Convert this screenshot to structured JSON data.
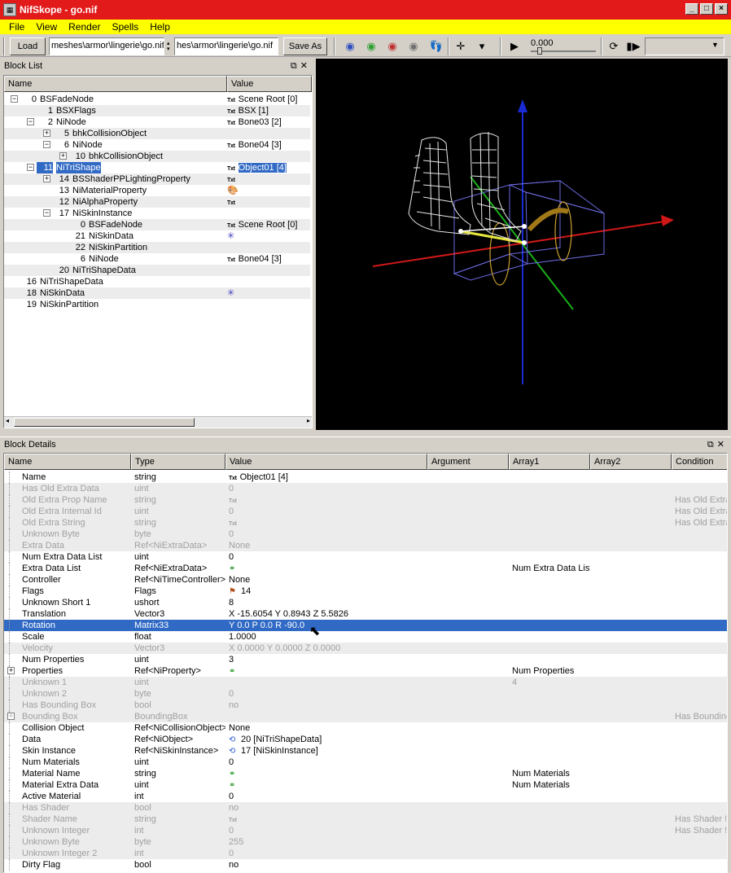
{
  "window": {
    "title": "NifSkope - go.nif",
    "controls": [
      "_",
      "□",
      "×"
    ]
  },
  "menu": [
    "File",
    "View",
    "Render",
    "Spells",
    "Help"
  ],
  "toolbar": {
    "load_label": "Load",
    "load_path": "meshes\\armor\\lingerie\\go.nif",
    "save_path": "hes\\armor\\lingerie\\go.nif",
    "save_label": "Save As",
    "time_value": "0.000"
  },
  "block_list": {
    "title": "Block List",
    "columns": [
      "Name",
      "Value"
    ],
    "rows": [
      {
        "num": "0",
        "name": "BSFadeNode",
        "value": "Scene Root [0]",
        "txt": true,
        "depth": 0,
        "toggle": "-"
      },
      {
        "num": "1",
        "name": "BSXFlags",
        "value": "BSX [1]",
        "txt": true,
        "depth": 1,
        "toggle": ""
      },
      {
        "num": "2",
        "name": "NiNode",
        "value": "Bone03 [2]",
        "txt": true,
        "depth": 1,
        "toggle": "-"
      },
      {
        "num": "5",
        "name": "bhkCollisionObject",
        "value": "",
        "txt": false,
        "depth": 2,
        "toggle": "+"
      },
      {
        "num": "6",
        "name": "NiNode",
        "value": "Bone04 [3]",
        "txt": true,
        "depth": 2,
        "toggle": "-"
      },
      {
        "num": "10",
        "name": "bhkCollisionObject",
        "value": "",
        "txt": false,
        "depth": 3,
        "toggle": "+"
      },
      {
        "num": "11",
        "name": "NiTriShape",
        "value": "Object01 [4]",
        "txt": true,
        "depth": 1,
        "toggle": "-",
        "selected": true
      },
      {
        "num": "14",
        "name": "BSShaderPPLightingProperty",
        "value": "",
        "txt": true,
        "depth": 2,
        "toggle": "+"
      },
      {
        "num": "13",
        "name": "NiMaterialProperty",
        "value": "",
        "icon": "palette-icon",
        "txt": false,
        "depth": 2,
        "toggle": ""
      },
      {
        "num": "12",
        "name": "NiAlphaProperty",
        "value": "",
        "txt": true,
        "depth": 2,
        "toggle": ""
      },
      {
        "num": "17",
        "name": "NiSkinInstance",
        "value": "",
        "txt": false,
        "depth": 2,
        "toggle": "-"
      },
      {
        "num": "0",
        "name": "BSFadeNode",
        "value": "Scene Root [0]",
        "txt": true,
        "depth": 3,
        "toggle": ""
      },
      {
        "num": "21",
        "name": "NiSkinData",
        "value": "",
        "icon": "axes-icon",
        "txt": false,
        "depth": 3,
        "toggle": ""
      },
      {
        "num": "22",
        "name": "NiSkinPartition",
        "value": "",
        "txt": false,
        "depth": 3,
        "toggle": ""
      },
      {
        "num": "6",
        "name": "NiNode",
        "value": "Bone04 [3]",
        "txt": true,
        "depth": 3,
        "toggle": ""
      },
      {
        "num": "20",
        "name": "NiTriShapeData",
        "value": "",
        "txt": false,
        "depth": 2,
        "toggle": ""
      },
      {
        "num": "16",
        "name": "NiTriShapeData",
        "value": "",
        "txt": false,
        "depth": 0,
        "toggle": ""
      },
      {
        "num": "18",
        "name": "NiSkinData",
        "value": "",
        "icon": "axes-icon",
        "txt": false,
        "depth": 0,
        "toggle": ""
      },
      {
        "num": "19",
        "name": "NiSkinPartition",
        "value": "",
        "txt": false,
        "depth": 0,
        "toggle": ""
      }
    ]
  },
  "block_details": {
    "title": "Block Details",
    "columns": [
      "Name",
      "Type",
      "Value",
      "Argument",
      "Array1",
      "Array2",
      "Condition"
    ],
    "rows": [
      {
        "name": "Name",
        "type": "string",
        "value": "Object01 [4]",
        "icon": "txt",
        "array1": "",
        "condition": "",
        "dim": false
      },
      {
        "name": "Has Old Extra Data",
        "type": "uint",
        "value": "0",
        "array1": "",
        "condition": "",
        "dim": true
      },
      {
        "name": "Old Extra Prop Name",
        "type": "string",
        "value": "",
        "icon": "txt",
        "array1": "",
        "condition": "Has Old Extra",
        "dim": true
      },
      {
        "name": "Old Extra Internal Id",
        "type": "uint",
        "value": "0",
        "array1": "",
        "condition": "Has Old Extra",
        "dim": true
      },
      {
        "name": "Old Extra String",
        "type": "string",
        "value": "",
        "icon": "txt",
        "array1": "",
        "condition": "Has Old Extra",
        "dim": true
      },
      {
        "name": "Unknown Byte",
        "type": "byte",
        "value": "0",
        "array1": "",
        "condition": "",
        "dim": true
      },
      {
        "name": "Extra Data",
        "type": "Ref<NiExtraData>",
        "value": "None",
        "array1": "",
        "condition": "",
        "dim": true
      },
      {
        "name": "Num Extra Data List",
        "type": "uint",
        "value": "0",
        "array1": "",
        "condition": "",
        "dim": false
      },
      {
        "name": "Extra Data List",
        "type": "Ref<NiExtraData>",
        "value": "",
        "icon": "link",
        "array1": "Num Extra Data List",
        "condition": "",
        "dim": false
      },
      {
        "name": "Controller",
        "type": "Ref<NiTimeController>",
        "value": "None",
        "array1": "",
        "condition": "",
        "dim": false
      },
      {
        "name": "Flags",
        "type": "Flags",
        "value": "14",
        "icon": "flag",
        "array1": "",
        "condition": "",
        "dim": false
      },
      {
        "name": "Unknown Short 1",
        "type": "ushort",
        "value": "8",
        "array1": "",
        "condition": "",
        "dim": false
      },
      {
        "name": "Translation",
        "type": "Vector3",
        "value": "X -15.6054 Y 0.8943 Z 5.5826",
        "array1": "",
        "condition": "",
        "dim": false
      },
      {
        "name": "Rotation",
        "type": "Matrix33",
        "value": "Y 0.0 P 0.0 R -90.0",
        "array1": "",
        "condition": "",
        "dim": false,
        "selected": true
      },
      {
        "name": "Scale",
        "type": "float",
        "value": "1.0000",
        "array1": "",
        "condition": "",
        "dim": false
      },
      {
        "name": "Velocity",
        "type": "Vector3",
        "value": "X 0.0000 Y 0.0000 Z 0.0000",
        "array1": "",
        "condition": "",
        "dim": true
      },
      {
        "name": "Num Properties",
        "type": "uint",
        "value": "3",
        "array1": "",
        "condition": "",
        "dim": false
      },
      {
        "name": "Properties",
        "type": "Ref<NiProperty>",
        "value": "",
        "icon": "link",
        "array1": "Num Properties",
        "condition": "",
        "dim": false,
        "toggle": "+"
      },
      {
        "name": "Unknown 1",
        "type": "uint",
        "value": "",
        "array1": "4",
        "condition": "",
        "dim": true
      },
      {
        "name": "Unknown 2",
        "type": "byte",
        "value": "0",
        "array1": "",
        "condition": "",
        "dim": true
      },
      {
        "name": "Has Bounding Box",
        "type": "bool",
        "value": "no",
        "array1": "",
        "condition": "",
        "dim": true
      },
      {
        "name": "Bounding Box",
        "type": "BoundingBox",
        "value": "",
        "array1": "",
        "condition": "Has Bounding",
        "dim": true,
        "toggle": "+"
      },
      {
        "name": "Collision Object",
        "type": "Ref<NiCollisionObject>",
        "value": "None",
        "array1": "",
        "condition": "",
        "dim": false
      },
      {
        "name": "Data",
        "type": "Ref<NiObject>",
        "value": "20 [NiTriShapeData]",
        "icon": "ref",
        "array1": "",
        "condition": "",
        "dim": false
      },
      {
        "name": "Skin Instance",
        "type": "Ref<NiSkinInstance>",
        "value": "17 [NiSkinInstance]",
        "icon": "ref",
        "array1": "",
        "condition": "",
        "dim": false
      },
      {
        "name": "Num Materials",
        "type": "uint",
        "value": "0",
        "array1": "",
        "condition": "",
        "dim": false
      },
      {
        "name": "Material Name",
        "type": "string",
        "value": "",
        "icon": "link",
        "array1": "Num Materials",
        "condition": "",
        "dim": false
      },
      {
        "name": "Material Extra Data",
        "type": "uint",
        "value": "",
        "icon": "link",
        "array1": "Num Materials",
        "condition": "",
        "dim": false
      },
      {
        "name": "Active Material",
        "type": "int",
        "value": "0",
        "array1": "",
        "condition": "",
        "dim": false
      },
      {
        "name": "Has Shader",
        "type": "bool",
        "value": "no",
        "array1": "",
        "condition": "",
        "dim": true
      },
      {
        "name": "Shader Name",
        "type": "string",
        "value": "",
        "icon": "txt",
        "array1": "",
        "condition": "Has Shader !",
        "dim": true
      },
      {
        "name": "Unknown Integer",
        "type": "int",
        "value": "0",
        "array1": "",
        "condition": "Has Shader !",
        "dim": true
      },
      {
        "name": "Unknown Byte",
        "type": "byte",
        "value": "255",
        "array1": "",
        "condition": "",
        "dim": true
      },
      {
        "name": "Unknown Integer 2",
        "type": "int",
        "value": "0",
        "array1": "",
        "condition": "",
        "dim": true
      },
      {
        "name": "Dirty Flag",
        "type": "bool",
        "value": "no",
        "array1": "",
        "condition": "",
        "dim": false
      }
    ]
  },
  "txt_label": "Txt"
}
